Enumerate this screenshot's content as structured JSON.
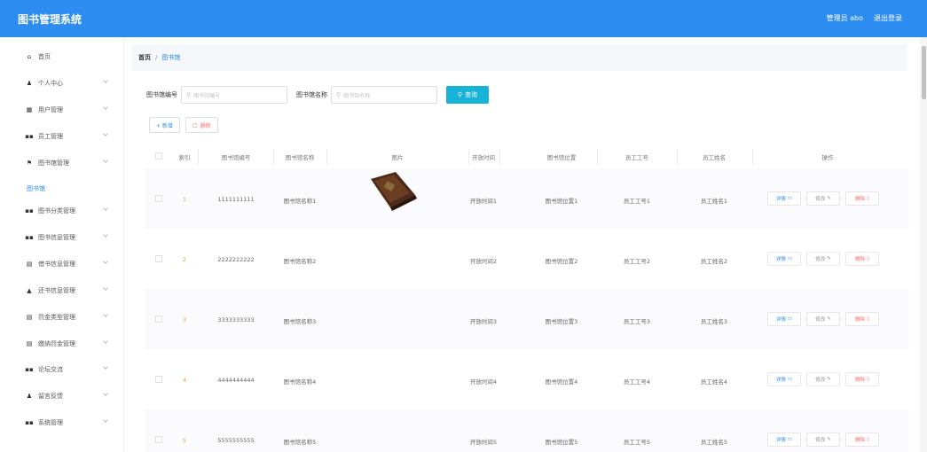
{
  "header": {
    "title": "图书管理系统",
    "user": "管理员 abo",
    "logout": "退出登录",
    "color": "#2d8cf0"
  },
  "sidebar": {
    "items": [
      {
        "label": "首页",
        "icon": "home-icon",
        "glyph": "⌂",
        "expandable": false
      },
      {
        "label": "个人中心",
        "icon": "user-icon",
        "glyph": "♟",
        "expandable": true
      },
      {
        "label": "用户管理",
        "icon": "user-manage-icon",
        "glyph": "▦",
        "expandable": true
      },
      {
        "label": "员工管理",
        "icon": "grid-icon",
        "glyph": "▪▪",
        "expandable": true
      },
      {
        "label": "图书馆管理",
        "icon": "flag-icon",
        "glyph": "⚑",
        "expandable": true
      },
      {
        "label": "图书馆",
        "icon": "",
        "glyph": "",
        "expandable": false,
        "sub": true
      },
      {
        "label": "图书分类管理",
        "icon": "grid-icon",
        "glyph": "▪▪",
        "expandable": true
      },
      {
        "label": "图书信息管理",
        "icon": "grid-icon",
        "glyph": "▪▪",
        "expandable": true
      },
      {
        "label": "借书信息管理",
        "icon": "book-icon",
        "glyph": "▤",
        "expandable": true
      },
      {
        "label": "还书信息管理",
        "icon": "stamp-icon",
        "glyph": "▲",
        "expandable": true
      },
      {
        "label": "罚金类型管理",
        "icon": "book-icon",
        "glyph": "▤",
        "expandable": true
      },
      {
        "label": "缴纳罚金管理",
        "icon": "book-icon",
        "glyph": "▤",
        "expandable": true
      },
      {
        "label": "论坛交流",
        "icon": "grid-icon",
        "glyph": "▪▪",
        "expandable": true
      },
      {
        "label": "留言反馈",
        "icon": "feedback-icon",
        "glyph": "♟",
        "expandable": true
      },
      {
        "label": "系统管理",
        "icon": "grid-icon",
        "glyph": "▪▪",
        "expandable": true
      }
    ]
  },
  "breadcrumb": {
    "home": "首页",
    "separator": "/",
    "current": "图书馆"
  },
  "search": {
    "field1_label": "图书馆编号",
    "field1_placeholder": "图书馆编号",
    "field2_label": "图书馆名称",
    "field2_placeholder": "图书馆名称",
    "button": "查询"
  },
  "actions": {
    "add": "+ 新增",
    "delete": "删除"
  },
  "table": {
    "columns": [
      "索引",
      "图书馆编号",
      "图书馆名称",
      "图片",
      "开放时间",
      "图书馆位置",
      "员工工号",
      "员工姓名",
      "操作"
    ],
    "rows": [
      {
        "index": "1",
        "code": "1111111111",
        "name": "图书馆名称1",
        "has_image": true,
        "open": "开放时间1",
        "location": "图书馆位置1",
        "emp_no": "员工工号1",
        "emp_name": "员工姓名1"
      },
      {
        "index": "2",
        "code": "2222222222",
        "name": "图书馆名称2",
        "has_image": false,
        "open": "开放时间2",
        "location": "图书馆位置2",
        "emp_no": "员工工号2",
        "emp_name": "员工姓名2"
      },
      {
        "index": "3",
        "code": "3333333333",
        "name": "图书馆名称3",
        "has_image": false,
        "open": "开放时间3",
        "location": "图书馆位置3",
        "emp_no": "员工工号3",
        "emp_name": "员工姓名3"
      },
      {
        "index": "4",
        "code": "4444444444",
        "name": "图书馆名称4",
        "has_image": false,
        "open": "开放时间4",
        "location": "图书馆位置4",
        "emp_no": "员工工号4",
        "emp_name": "员工姓名4"
      },
      {
        "index": "5",
        "code": "5555555555",
        "name": "图书馆名称5",
        "has_image": false,
        "open": "开放时间5",
        "location": "图书馆位置5",
        "emp_no": "员工工号5",
        "emp_name": "员工姓名5"
      }
    ],
    "ops": {
      "detail": "详情",
      "edit": "修改",
      "delete": "删除"
    }
  }
}
